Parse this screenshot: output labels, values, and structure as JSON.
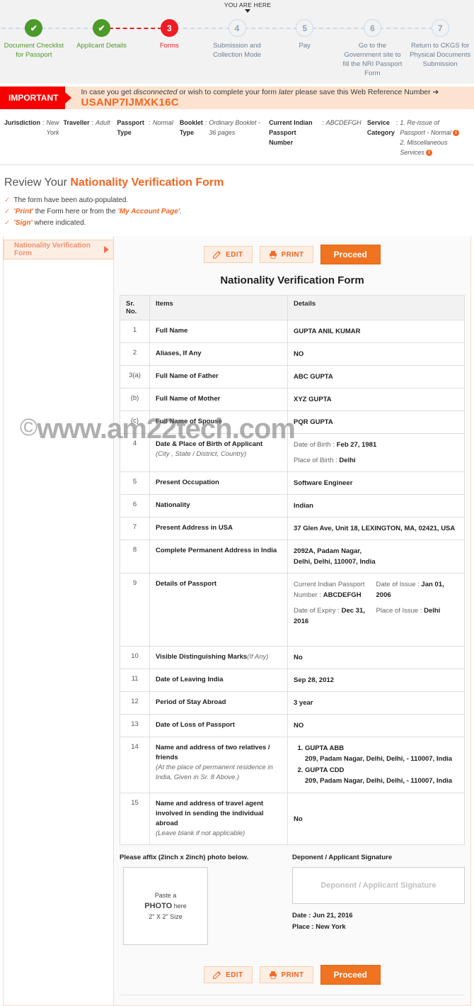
{
  "stepper": {
    "you_are_here": "YOU ARE HERE",
    "steps": [
      {
        "num": "✔",
        "label": "Document Checklist for Passport",
        "state": "done"
      },
      {
        "num": "✔",
        "label": "Applicant Details",
        "state": "done"
      },
      {
        "num": "3",
        "label": "Forms",
        "state": "current"
      },
      {
        "num": "4",
        "label": "Submission and Collection Mode",
        "state": "todo"
      },
      {
        "num": "5",
        "label": "Pay",
        "state": "todo"
      },
      {
        "num": "6",
        "label": "Go to the Government site to fill the NRI Passport Form",
        "state": "todo"
      },
      {
        "num": "7",
        "label": "Return to CKGS for Physical Documents Submission",
        "state": "todo"
      }
    ]
  },
  "important": {
    "tag": "IMPORTANT",
    "text_1": "In case you get ",
    "text_em1": "disconnected",
    "text_2": " or wish to complete your form ",
    "text_em2": "later",
    "text_3": " please save this Web Reference Number ",
    "arrow": "➔",
    "reference_number": "USANP7IJMXK16C"
  },
  "jurisdiction": [
    {
      "key": "Jurisdiction",
      "sep": ":",
      "value": "New York"
    },
    {
      "key": "Traveller",
      "sep": ":",
      "value": "Adult"
    },
    {
      "key": "Passport Type",
      "sep": ":",
      "value": "Normal"
    },
    {
      "key": "Booklet Type",
      "sep": ":",
      "value": "Ordinary Booklet - 36 pages"
    },
    {
      "key": "Current Indian Passport Number",
      "sep": ":",
      "value": "ABCDEFGH"
    },
    {
      "key": "Service Category",
      "sep": ":",
      "value_1": "1. Re-issue of Passport - Normal",
      "value_2": "2. Miscellaneous Services"
    }
  ],
  "review": {
    "heading_light": "Review Your ",
    "heading_bold": "Nationality Verification Form",
    "bullets": [
      {
        "pre": "The form have been auto-populated.",
        "em": "",
        "post": ""
      },
      {
        "pre": "",
        "em": "'Print'",
        "post": " the Form here or from the ",
        "em2": "'My Account Page'",
        "post2": "."
      },
      {
        "pre": "",
        "em": "'Sign'",
        "post": " where indicated."
      }
    ]
  },
  "sidebar": {
    "tab_label": "Nationality Verification Form"
  },
  "toolbar": {
    "edit_label": "EDIT",
    "print_label": "PRINT",
    "proceed_label": "Proceed"
  },
  "form": {
    "title": "Nationality Verification Form",
    "columns": {
      "sr": "Sr. No.",
      "items": "Items",
      "details": "Details"
    },
    "rows": [
      {
        "sr": "1",
        "item": "Full Name",
        "note": "",
        "detail": "GUPTA ANIL KUMAR"
      },
      {
        "sr": "2",
        "item": "Aliases, If Any",
        "note": "",
        "detail": "NO"
      },
      {
        "sr": "3(a)",
        "item": "Full Name of Father",
        "note": "",
        "detail": "ABC GUPTA"
      },
      {
        "sr": "(b)",
        "item": "Full Name of Mother",
        "note": "",
        "detail": "XYZ GUPTA"
      },
      {
        "sr": "(c)",
        "item": "Full Name of Spouse",
        "note": "",
        "detail": "PQR GUPTA"
      },
      {
        "sr": "4",
        "item": "Date & Place of Birth of Applicant",
        "note": "(City , State / District, Country)",
        "kv": [
          {
            "label": "Date of Birth : ",
            "value": "Feb 27, 1981"
          },
          {
            "label": "Place of Birth : ",
            "value": "Delhi"
          }
        ]
      },
      {
        "sr": "5",
        "item": "Present Occupation",
        "note": "",
        "detail": "Software Engineer"
      },
      {
        "sr": "6",
        "item": "Nationality",
        "note": "",
        "detail": "Indian"
      },
      {
        "sr": "7",
        "item": "Present Address in USA",
        "note": "",
        "detail": "37 Glen Ave, Unit 18, LEXINGTON, MA, 02421, USA"
      },
      {
        "sr": "8",
        "item": "Complete Permanent Address in India",
        "note": "",
        "detail_line1": "2092A, Padam Nagar,",
        "detail_line2": "Delhi, Delhi, 110007, India"
      },
      {
        "sr": "9",
        "item": "Details of Passport",
        "note": "",
        "passport": {
          "number_label": "Current Indian Passport Number : ",
          "number_value": "ABCDEFGH",
          "issue_label": "Date of Issue : ",
          "issue_value": "Jan 01, 2006",
          "expiry_label": "Date of Expiry : ",
          "expiry_value": "Dec 31, 2016",
          "place_label": "Place of Issue : ",
          "place_value": "Delhi"
        }
      },
      {
        "sr": "10",
        "item": "Visible Distinguishing Marks",
        "note": "(If Any)",
        "detail": "No"
      },
      {
        "sr": "11",
        "item": "Date of Leaving India",
        "note": "",
        "detail": "Sep 28, 2012"
      },
      {
        "sr": "12",
        "item": "Period of Stay Abroad",
        "note": "",
        "detail": "3 year"
      },
      {
        "sr": "13",
        "item": "Date of Loss of Passport",
        "note": "",
        "detail": "NO"
      },
      {
        "sr": "14",
        "item": "Name and address of two relatives / friends",
        "note": "(At the place of permanent residence in India, Given in Sr. 8 Above.)",
        "relatives": [
          {
            "name": "GUPTA ABB",
            "address": "209, Padam Nagar, Delhi, Delhi, - 110007, India"
          },
          {
            "name": "GUPTA CDD",
            "address": "209, Padam Nagar, Delhi, Delhi, - 110007, India"
          }
        ]
      },
      {
        "sr": "15",
        "item": "Name and address of travel agent involved in sending the individual abroad",
        "note": "(Leave blank if not applicable)",
        "detail": "No"
      }
    ]
  },
  "photo_section": {
    "photo_heading": "Please affix (2inch x 2inch) photo below.",
    "photo_line1": "Paste a",
    "photo_line2": "PHOTO",
    "photo_line2b": " here",
    "photo_line3": "2\" X 2\" Size",
    "sign_heading": "Deponent / Applicant Signature",
    "sign_placeholder": "Deponent / Applicant Signature",
    "date_label": "Date : ",
    "date_value": "Jun 21, 2016",
    "place_label": "Place : ",
    "place_value": "New York"
  },
  "watermark": {
    "symbol": "©",
    "text": "www.am22tech.com"
  },
  "colors": {
    "accent_orange": "#f26522",
    "primary_button": "#f07321",
    "alert_red": "#f70000",
    "done_green": "#4c9a2a",
    "current_red": "#ee1c25",
    "todo_blue": "#c9dced"
  }
}
